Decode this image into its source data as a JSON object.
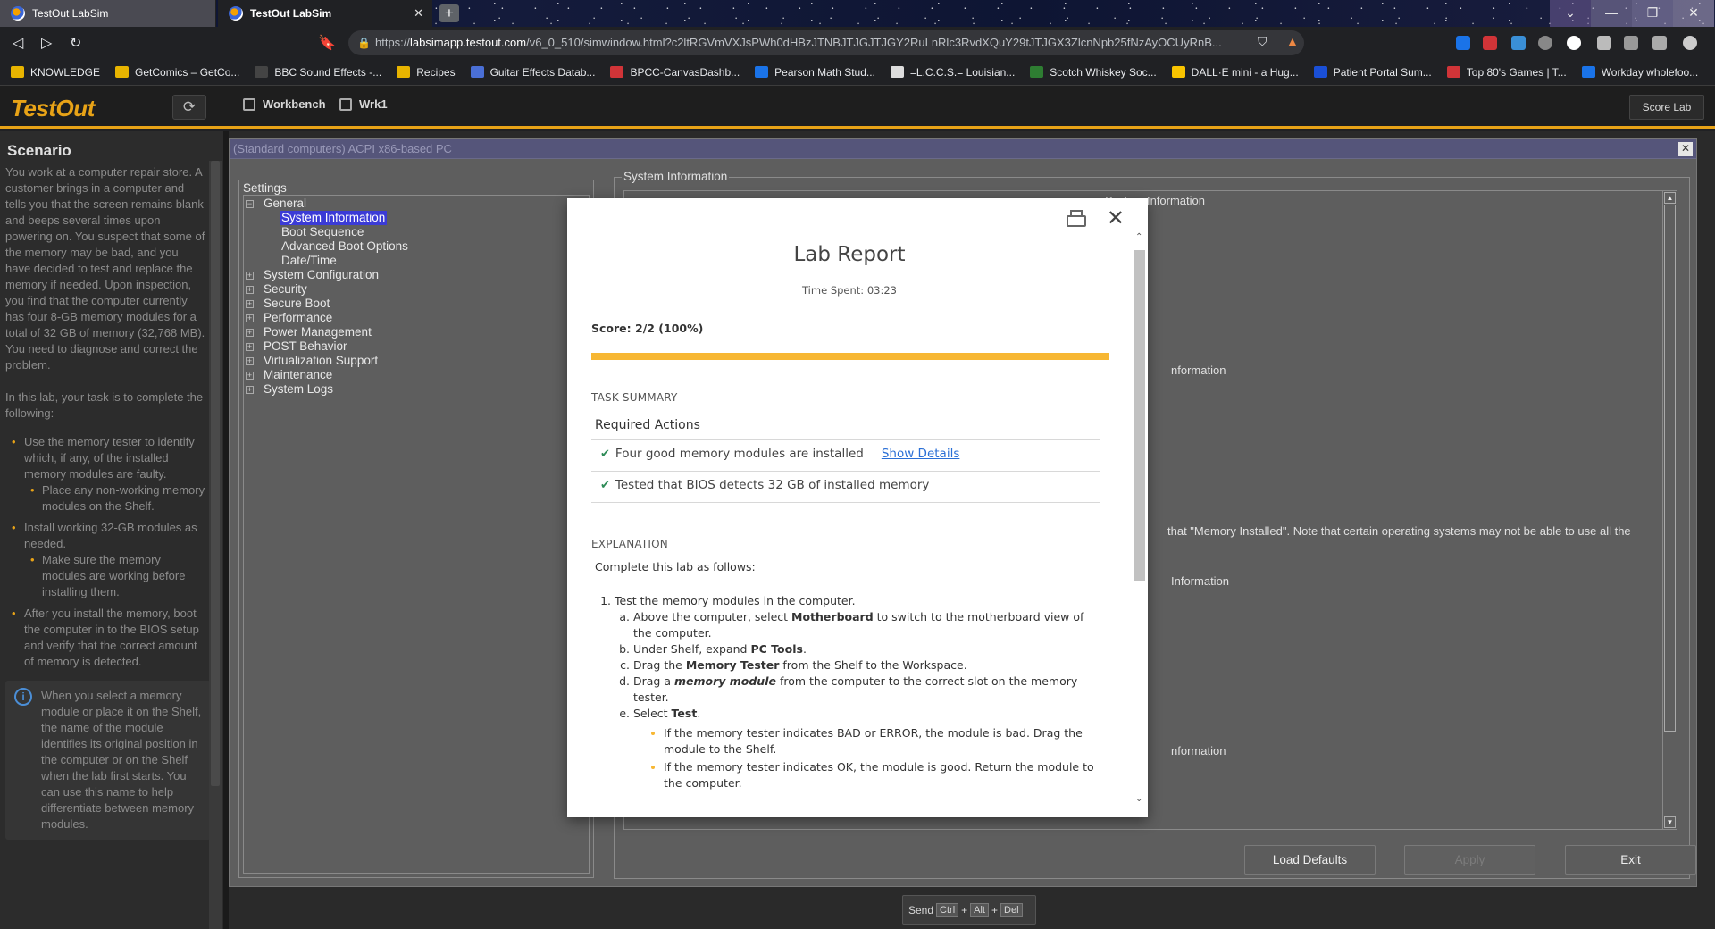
{
  "browser": {
    "tabs": [
      {
        "label": "TestOut LabSim"
      },
      {
        "label": "TestOut LabSim"
      }
    ],
    "url_prefix": "https://",
    "url_host": "labsimapp.testout.com",
    "url_path": "/v6_0_510/simwindow.html?c2ltRGVmVXJsPWh0dHBzJTNBJTJGJTJGY2RuLnRlc3RvdXQuY29tJTJGX3ZlcnNpb25fNzAyOCUyRnB...",
    "bookmarks": [
      {
        "label": "KNOWLEDGE",
        "color": "#e8b400"
      },
      {
        "label": "GetComics – GetCo...",
        "color": "#e8b400"
      },
      {
        "label": "BBC Sound Effects -...",
        "color": "#444"
      },
      {
        "label": "Recipes",
        "color": "#e8b400"
      },
      {
        "label": "Guitar Effects Datab...",
        "color": "#4a6fd6"
      },
      {
        "label": "BPCC-CanvasDashb...",
        "color": "#d13438"
      },
      {
        "label": "Pearson Math Stud...",
        "color": "#1a73e8"
      },
      {
        "label": "=L.C.C.S.= Louisian...",
        "color": "#ddd"
      },
      {
        "label": "Scotch Whiskey Soc...",
        "color": "#2e7d32"
      },
      {
        "label": "DALL·E mini - a Hug...",
        "color": "#f9c400"
      },
      {
        "label": "Patient Portal Sum...",
        "color": "#1a4fd6"
      },
      {
        "label": "Top 80's Games | T...",
        "color": "#d13438"
      },
      {
        "label": "Workday wholefoo...",
        "color": "#1a73e8"
      }
    ]
  },
  "app": {
    "logo": "TestOut",
    "breadcrumbs": [
      "Workbench",
      "Wrk1"
    ],
    "score_lab": "Score Lab",
    "accent": "#e8a317"
  },
  "scenario": {
    "title": "Scenario",
    "intro": "You work at a computer repair store. A customer brings in a computer and tells you that the screen remains blank and beeps several times upon powering on. You suspect that some of the memory may be bad, and you have decided to test and replace the memory if needed. Upon inspection, you find that the computer currently has four 8-GB memory modules for a total of 32 GB of memory (32,768 MB). You need to diagnose and correct the problem.",
    "task_intro": "In this lab, your task is to complete the following:",
    "tasks": [
      {
        "text": "Use the memory tester to identify which, if any, of the installed memory modules are faulty.",
        "sub": [
          "Place any non-working memory modules on the Shelf."
        ]
      },
      {
        "text": "Install working 32-GB modules as needed.",
        "sub": [
          "Make sure the memory modules are working before installing them."
        ]
      },
      {
        "text": "After you install the memory, boot the computer in to the BIOS setup and verify that the correct amount of memory is detected.",
        "sub": []
      }
    ],
    "note": "When you select a memory module or place it on the Shelf, the name of the module identifies its original position in the computer or on the Shelf when the lab first starts. You can use this name to help differentiate between memory modules."
  },
  "sim": {
    "window_title": "(Standard computers) ACPI x86-based PC",
    "settings_label": "Settings",
    "tree": {
      "general": "General",
      "general_children": [
        "System Information",
        "Boot Sequence",
        "Advanced Boot Options",
        "Date/Time"
      ],
      "others": [
        "System Configuration",
        "Security",
        "Secure Boot",
        "Performance",
        "Power Management",
        "POST Behavior",
        "Virtualization Support",
        "Maintenance",
        "System Logs"
      ]
    },
    "sysinfo_label": "System Information",
    "sysinfo_lines": [
      "System Information",
      "nformation",
      "that \"Memory Installed\". Note that certain operating systems may not be able to use all the",
      "Information",
      "nformation"
    ],
    "buttons": {
      "load_defaults": "Load Defaults",
      "apply": "Apply",
      "exit": "Exit"
    },
    "send": {
      "label": "Send",
      "keys": [
        "Ctrl",
        "Alt",
        "Del"
      ]
    }
  },
  "modal": {
    "title": "Lab Report",
    "time_spent": "Time Spent: 03:23",
    "score": "Score: 2/2 (100%)",
    "score_fraction": 1.0,
    "task_summary_label": "TASK SUMMARY",
    "required_actions": "Required Actions",
    "tasks": [
      {
        "text": "Four good memory modules are installed",
        "link": "Show Details"
      },
      {
        "text": "Tested that BIOS detects 32 GB of installed memory",
        "link": ""
      }
    ],
    "explanation_label": "EXPLANATION",
    "explanation_intro": "Complete this lab as follows:",
    "step1": "Test the memory modules in the computer.",
    "step1a_pre": "Above the computer, select ",
    "step1a_b": "Motherboard",
    "step1a_post": " to switch to the motherboard view of the computer.",
    "step1b_pre": "Under Shelf, expand ",
    "step1b_b": "PC Tools",
    "step1b_post": ".",
    "step1c_pre": "Drag the ",
    "step1c_b": "Memory Tester",
    "step1c_post": " from the Shelf to the Workspace.",
    "step1d_pre": "Drag a ",
    "step1d_b": "memory module",
    "step1d_post": " from the computer to the correct slot on the memory tester.",
    "step1e_pre": "Select ",
    "step1e_b": "Test",
    "step1e_post": ".",
    "bullets": [
      "If the memory tester indicates BAD or ERROR, the module is bad. Drag the module to the Shelf.",
      "If the memory tester indicates OK, the module is good. Return the module to the computer."
    ]
  }
}
